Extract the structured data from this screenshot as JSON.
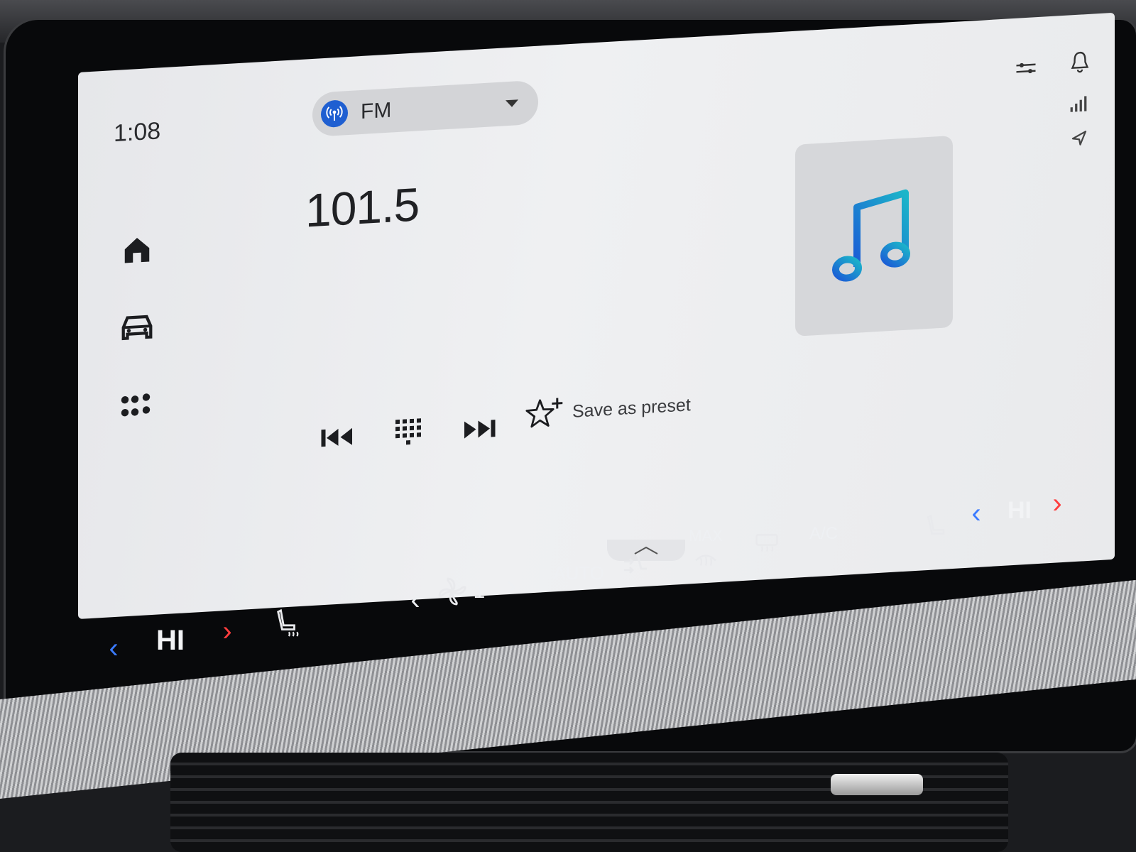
{
  "status": {
    "time": "1:08"
  },
  "source": {
    "label": "FM",
    "icon": "radio-broadcast-icon"
  },
  "station": {
    "frequency": "101.5"
  },
  "controls": {
    "prev_icon": "skip-previous-icon",
    "keypad_icon": "keypad-icon",
    "next_icon": "skip-next-icon",
    "preset_label": "Save as preset"
  },
  "climate": {
    "driver_temp": "HI",
    "passenger_temp": "HI",
    "fan_speed": "1",
    "auto_label": "AUTO",
    "max_label": "MAX",
    "ac_label": "A/C"
  },
  "colors": {
    "accent_blue": "#1f5fd1",
    "note_gradient_start": "#1b5bd6",
    "note_gradient_end": "#1cb6c9",
    "temp_down": "#3b7bff",
    "temp_up": "#ff3d3d"
  }
}
